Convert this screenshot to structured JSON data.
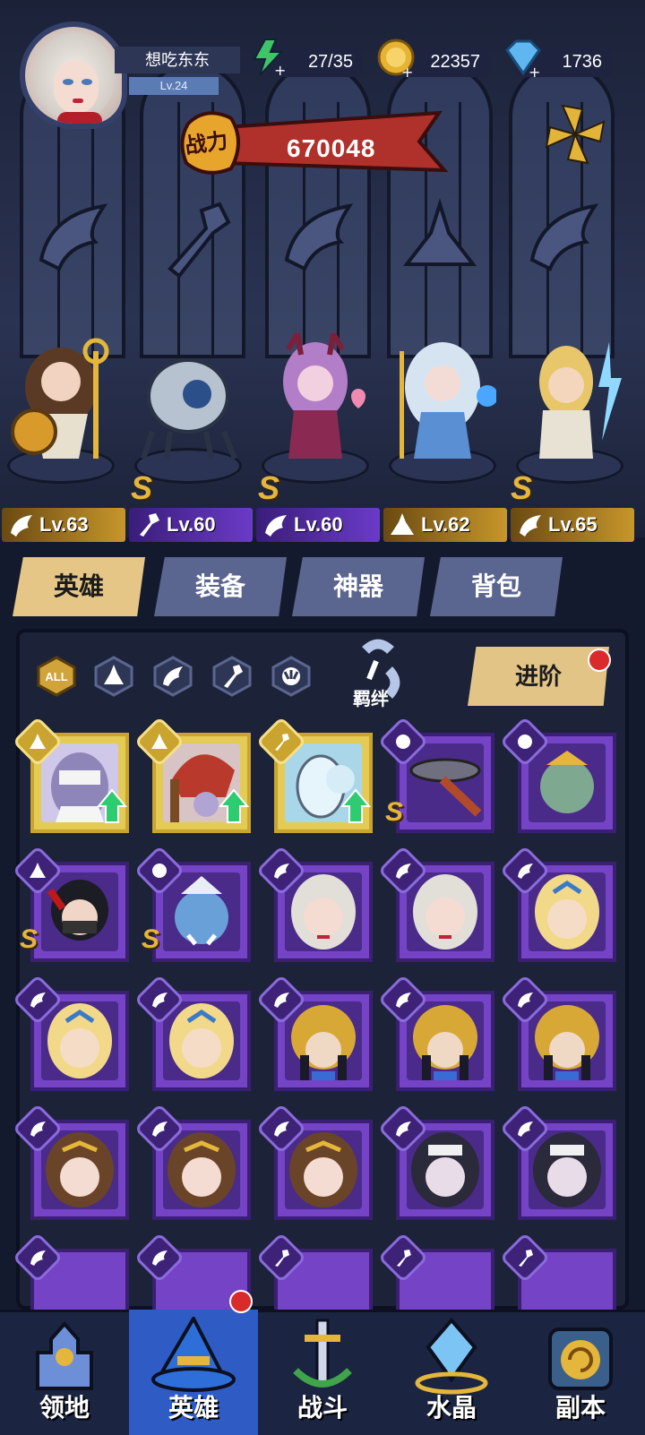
{
  "player": {
    "name": "想吃东东",
    "level": "Lv.24"
  },
  "resources": {
    "stamina": "27/35",
    "gold": "22357",
    "gems": "1736"
  },
  "power": {
    "label": "战力",
    "value": "670048"
  },
  "team": [
    {
      "level": "Lv.63",
      "class": "wing-icon",
      "plate": "gold",
      "s_rank": false
    },
    {
      "level": "Lv.60",
      "class": "wrench-icon",
      "plate": "purple",
      "s_rank": true
    },
    {
      "level": "Lv.60",
      "class": "wing-icon",
      "plate": "purple",
      "s_rank": true
    },
    {
      "level": "Lv.62",
      "class": "flask-icon",
      "plate": "gold",
      "s_rank": false
    },
    {
      "level": "Lv.65",
      "class": "wing-icon",
      "plate": "gold",
      "s_rank": true
    }
  ],
  "tabs": [
    "英雄",
    "装备",
    "神器",
    "背包"
  ],
  "filters": {
    "all": "ALL"
  },
  "bond_label": "羁绊",
  "advance_label": "进阶",
  "nav": [
    "领地",
    "英雄",
    "战斗",
    "水晶",
    "副本"
  ],
  "colors": {
    "gold_accent": "#e5c686",
    "purple_rarity": "#7543c6",
    "gold_rarity": "#e4cb56",
    "active_nav": "#2e5bc4"
  }
}
